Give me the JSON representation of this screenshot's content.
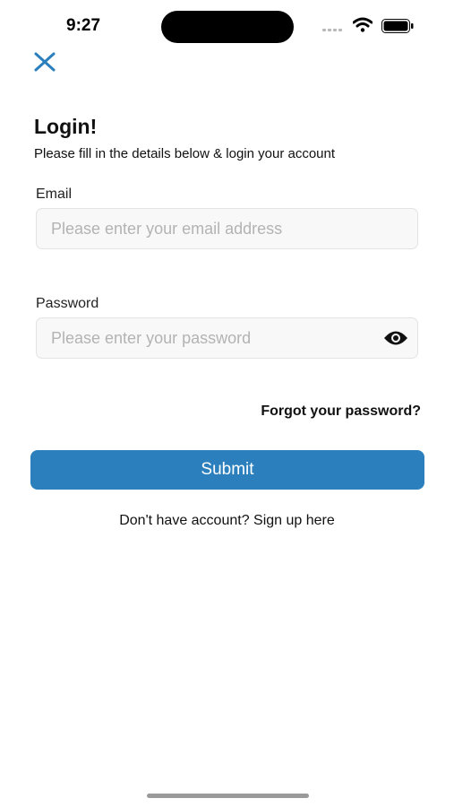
{
  "status_bar": {
    "time": "9:27",
    "icons": [
      "cellular-signal-icon",
      "wifi-icon",
      "battery-icon"
    ]
  },
  "nav": {
    "close_icon": "close-icon"
  },
  "header": {
    "title": "Login!",
    "subtitle": "Please fill in the details below & login your account"
  },
  "form": {
    "email": {
      "label": "Email",
      "placeholder": "Please enter your email address",
      "value": ""
    },
    "password": {
      "label": "Password",
      "placeholder": "Please enter your password",
      "value": "",
      "toggle_icon": "eye-icon"
    },
    "forgot_label": "Forgot your password?",
    "submit_label": "Submit",
    "signup_label": "Don't have account? Sign up here"
  },
  "colors": {
    "accent": "#2a7fbc",
    "field_background": "#f8f8f8",
    "field_border": "#e3e3e3",
    "placeholder": "#b3b3b3"
  }
}
